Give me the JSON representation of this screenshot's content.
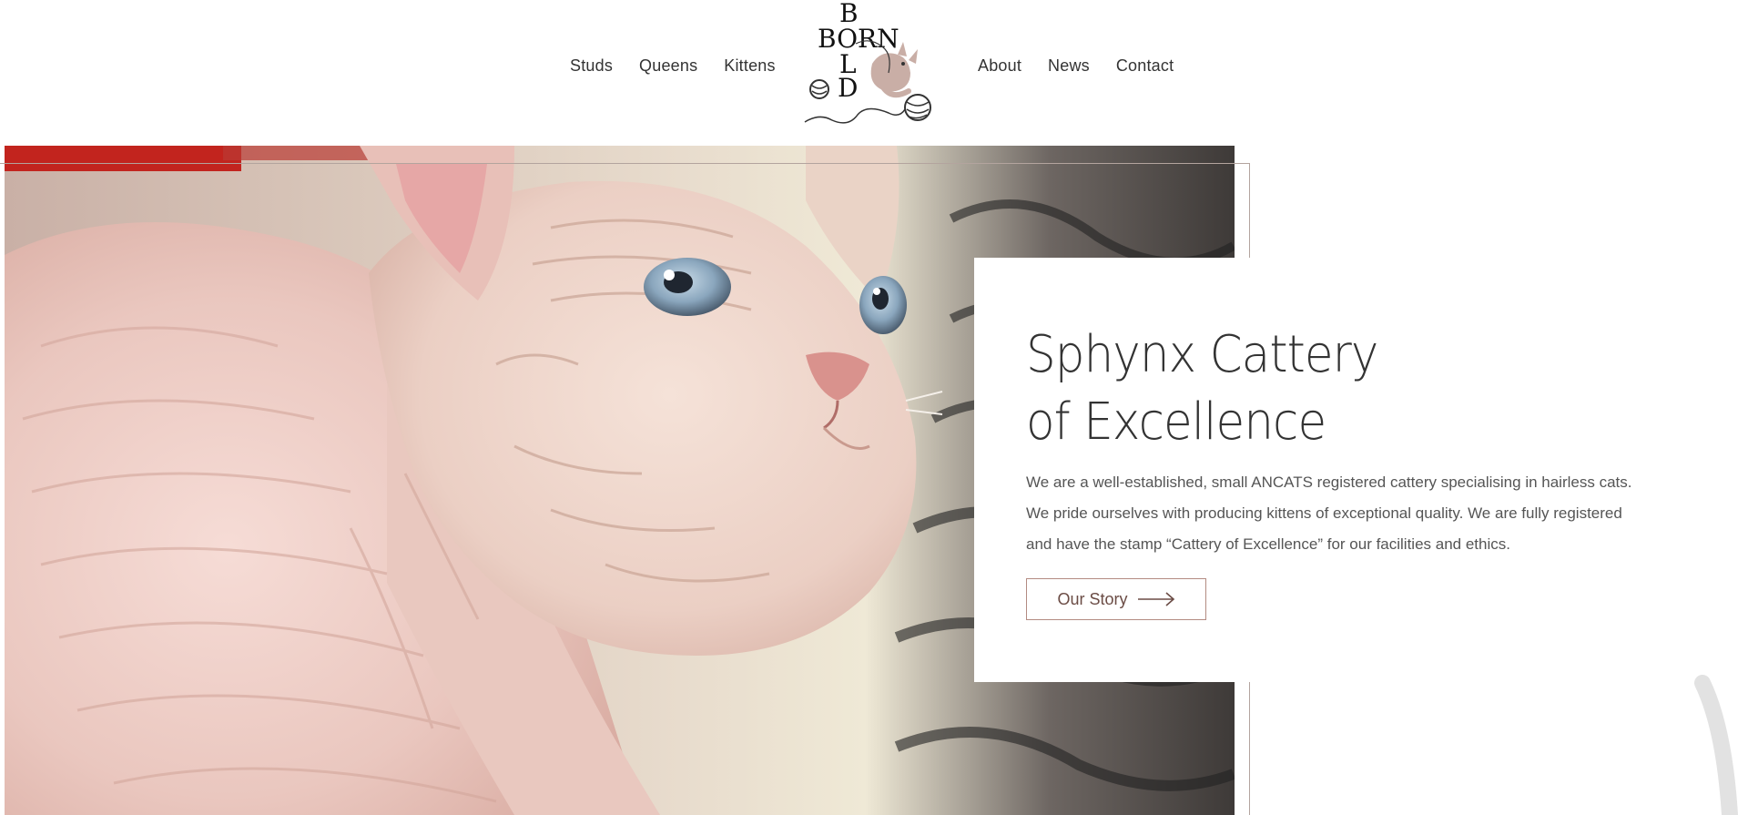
{
  "nav": {
    "left": [
      {
        "label": "Studs"
      },
      {
        "label": "Queens"
      },
      {
        "label": "Kittens"
      }
    ],
    "right": [
      {
        "label": "About"
      },
      {
        "label": "News"
      },
      {
        "label": "Contact"
      }
    ]
  },
  "logo": {
    "letters_top": "B",
    "letters_row": "BORN",
    "letters_mid": "L",
    "letters_bottom": "D"
  },
  "hero": {
    "title_line1": "Sphynx Cattery",
    "title_line2": "of Excellence",
    "desc_line1": "We are a well-established, small ANCATS registered cattery specialising in hairless cats.",
    "desc_line2": "We pride ourselves with producing kittens of exceptional quality. We are fully registered",
    "desc_line3": "and have the stamp “Cattery of Excellence” for our facilities and ethics.",
    "button_label": "Our Story"
  },
  "colors": {
    "accent": "#b38b82",
    "button_text": "#6b4c45",
    "frame": "#b3a49e"
  }
}
